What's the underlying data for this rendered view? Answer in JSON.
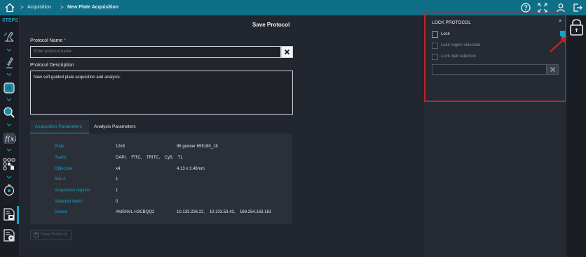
{
  "breadcrumb": {
    "items": [
      "Acquisition",
      "New Plate Acquisition"
    ]
  },
  "topbar": {
    "icons": [
      "home-icon",
      "help-icon",
      "fullscreen-icon",
      "user-icon",
      "logout-icon"
    ]
  },
  "steps": {
    "label": "STEPS"
  },
  "save_protocol": {
    "title": "Save Protocol",
    "name_label": "Protocol Name",
    "required_mark": "*",
    "name_placeholder": "Enter protocol name",
    "desc_label": "Protocol Description",
    "desc_value": "New self-guided plate acquisition and analysis.",
    "save_button": "Save Protocol"
  },
  "tabs": [
    "Acquisition Parameters",
    "Analysis Parameters"
  ],
  "parameters": [
    {
      "key": "Plate",
      "v1": "12x8",
      "v2": "96 greiner 655180_18"
    },
    {
      "key": "Stains",
      "v1": "DAPI,    FITC,    TRITC,    Cy5,    TL",
      "v2": ""
    },
    {
      "key": "Objective",
      "v1": "x4",
      "v2": "4.13 x 3.46mm"
    },
    {
      "key": "Site #",
      "v1": "1",
      "v2": ""
    },
    {
      "key": "Acquisition regions",
      "v1": "1",
      "v2": ""
    },
    {
      "key": "Selected Wells",
      "v1": "0",
      "v2": ""
    },
    {
      "key": "Device",
      "v1": "AMSNVL-H3CBQQ2",
      "v2": "10.133.226.22,    10.133.53.43,    169.254.163.161"
    }
  ],
  "lock_protocol": {
    "title": "LOCK PROTOCOL",
    "close": "×",
    "options": [
      {
        "label": "Lock",
        "enabled": true
      },
      {
        "label": "Lock region selection",
        "enabled": false
      },
      {
        "label": "Lock well selection",
        "enabled": false
      }
    ]
  },
  "colors": {
    "accent": "#17a3c4",
    "topbar": "#0f6f86",
    "highlight": "#c1232b"
  }
}
